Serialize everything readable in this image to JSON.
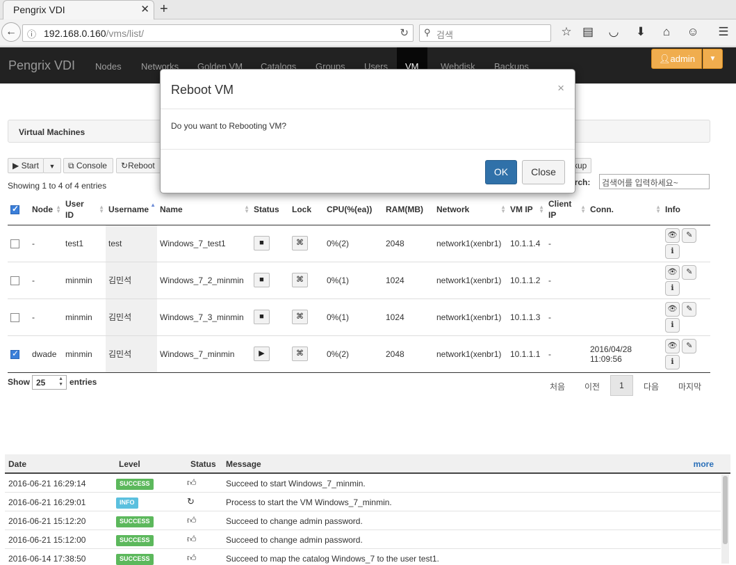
{
  "browser": {
    "tab_title": "Pengrix VDI",
    "url_host": "192.168.0.160",
    "url_path": "/vms/list/",
    "search_placeholder": "검색"
  },
  "app": {
    "brand": "Pengrix VDI",
    "nav": [
      "Nodes",
      "Networks",
      "Golden VM",
      "Catalogs",
      "Groups",
      "Users",
      "VM",
      "Webdisk",
      "Backups"
    ],
    "active_nav": "VM",
    "user": "admin",
    "accent_color": "#f0ad4e"
  },
  "panel": {
    "title": "Virtual Machines"
  },
  "toolbar": {
    "start": "Start",
    "console": "Console",
    "reboot": "Reboot",
    "backup_partial": "kup"
  },
  "table": {
    "showing": "Showing 1 to 4 of 4 entries",
    "search_label": "arch:",
    "search_placeholder": "검색어를 입력하세요~",
    "headers": {
      "node": "Node",
      "userid": "User ID",
      "username": "Username",
      "name": "Name",
      "status": "Status",
      "lock": "Lock",
      "cpu": "CPU(%(ea))",
      "ram": "RAM(MB)",
      "network": "Network",
      "vmip": "VM IP",
      "clientip": "Client IP",
      "conn": "Conn.",
      "info": "Info"
    },
    "rows": [
      {
        "node": "-",
        "userid": "test1",
        "username": "test",
        "name": "Windows_7_test1",
        "cpu": "0%(2)",
        "ram": "2048",
        "network": "network1(xenbr1)",
        "vmip": "10.1.1.4",
        "clientip": "-",
        "conn": ""
      },
      {
        "node": "-",
        "userid": "minmin",
        "username": "김민석",
        "name": "Windows_7_2_minmin",
        "cpu": "0%(1)",
        "ram": "1024",
        "network": "network1(xenbr1)",
        "vmip": "10.1.1.2",
        "clientip": "-",
        "conn": ""
      },
      {
        "node": "-",
        "userid": "minmin",
        "username": "김민석",
        "name": "Windows_7_3_minmin",
        "cpu": "0%(1)",
        "ram": "1024",
        "network": "network1(xenbr1)",
        "vmip": "10.1.1.3",
        "clientip": "-",
        "conn": ""
      },
      {
        "node": "dwade",
        "userid": "minmin",
        "username": "김민석",
        "name": "Windows_7_minmin",
        "cpu": "0%(2)",
        "ram": "2048",
        "network": "network1(xenbr1)",
        "vmip": "10.1.1.1",
        "clientip": "-",
        "conn_date": "2016/04/28",
        "conn_time": "11:09:56"
      }
    ],
    "show_label": "Show",
    "page_size": "25",
    "entries_label": "entries",
    "pagination": {
      "first": "처음",
      "prev": "이전",
      "current": "1",
      "next": "다음",
      "last": "마지막"
    }
  },
  "log": {
    "headers": {
      "date": "Date",
      "level": "Level",
      "status": "Status",
      "message": "Message",
      "more": "more"
    },
    "rows": [
      {
        "date": "2016-06-21 16:29:14",
        "level": "SUCCESS",
        "message": "Succeed to start Windows_7_minmin."
      },
      {
        "date": "2016-06-21 16:29:01",
        "level": "INFO",
        "message": "Process to start the VM Windows_7_minmin."
      },
      {
        "date": "2016-06-21 15:12:20",
        "level": "SUCCESS",
        "message": "Succeed to change admin password."
      },
      {
        "date": "2016-06-21 15:12:00",
        "level": "SUCCESS",
        "message": "Succeed to change admin password."
      },
      {
        "date": "2016-06-14 17:38:50",
        "level": "SUCCESS",
        "message": "Succeed to map the catalog Windows_7 to the user test1."
      }
    ]
  },
  "modal": {
    "title": "Reboot VM",
    "body": "Do you want to Rebooting VM?",
    "ok": "OK",
    "close": "Close"
  }
}
